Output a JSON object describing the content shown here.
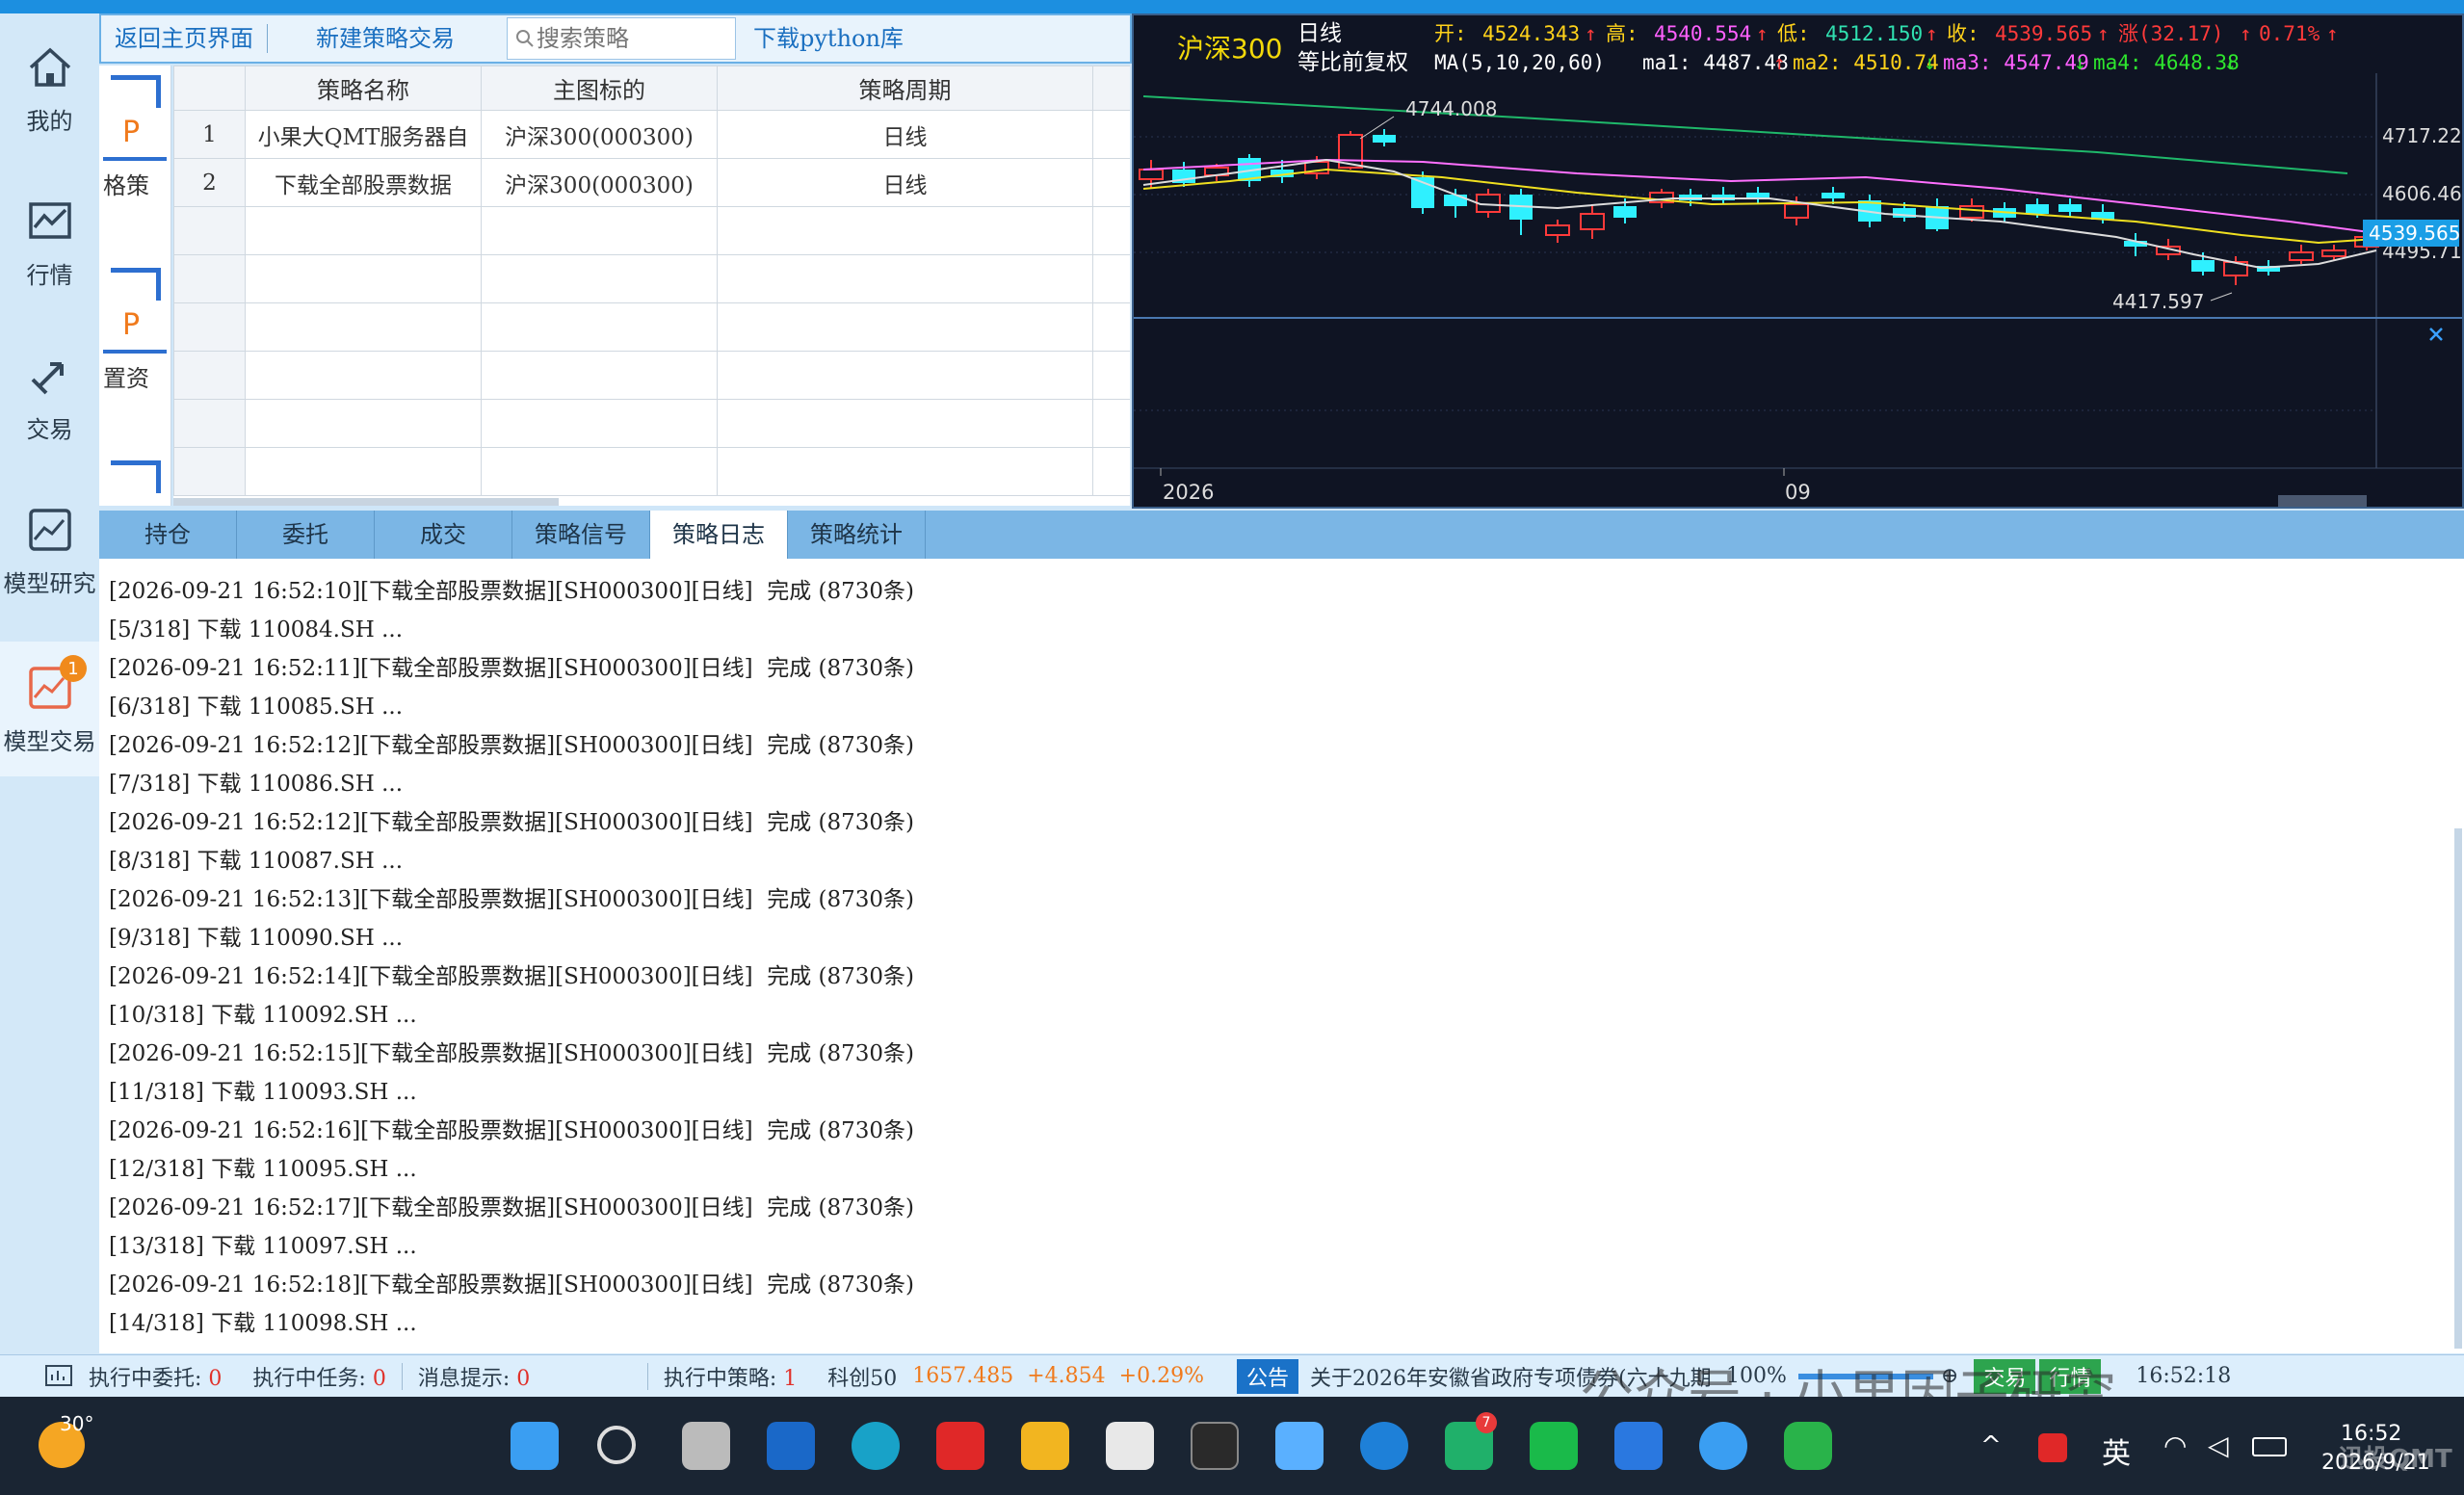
{
  "sidebar": {
    "items": [
      {
        "label": "我的"
      },
      {
        "label": "行情"
      },
      {
        "label": "交易"
      },
      {
        "label": "模型研究"
      },
      {
        "label": "模型交易",
        "badge": "1"
      }
    ]
  },
  "toolbar": {
    "back_label": "返回主页界面",
    "new_label": "新建策略交易",
    "search_placeholder": "搜索策略",
    "download_label": "下载python库"
  },
  "strategy_side": {
    "cards": [
      {
        "tag": "P",
        "text": "格策"
      },
      {
        "tag": "P",
        "text": "置资"
      }
    ]
  },
  "strategy_table": {
    "headers": [
      "策略名称",
      "主图标的",
      "策略周期"
    ],
    "rows": [
      {
        "idx": "1",
        "name": "小果大QMT服务器自",
        "symbol": "沪深300(000300)",
        "period": "日线"
      },
      {
        "idx": "2",
        "name": "下载全部股票数据",
        "symbol": "沪深300(000300)",
        "period": "日线"
      }
    ]
  },
  "chart": {
    "name": "沪深300",
    "period": "日线",
    "adjust": "等比前复权",
    "open_label": "开:",
    "open": "4524.343",
    "high_label": "高:",
    "high": "4540.554",
    "low_label": "低:",
    "low": "4512.150",
    "close_label": "收:",
    "close": "4539.565",
    "change_label": "涨(32.17)",
    "change_pct": "0.71%",
    "ma_label": "MA(5,10,20,60)",
    "ma1": "ma1: 4487.48",
    "ma2": "ma2: 4510.74",
    "ma3": "ma3: 4547.49",
    "ma4": "ma4: 4648.38",
    "price_labels": [
      "4717.224",
      "4606.468",
      "4495.712"
    ],
    "current_price": "4539.565",
    "peak": "4744.008",
    "trough": "4417.597",
    "x_labels": [
      "2026",
      "09"
    ],
    "close_icon": "close-icon"
  },
  "tabs": [
    "持仓",
    "委托",
    "成交",
    "策略信号",
    "策略日志",
    "策略统计"
  ],
  "active_tab": "策略日志",
  "log_lines": [
    "[2026-09-21 16:52:10][下载全部股票数据][SH000300][日线]  完成 (8730条)",
    "[5/318] 下载 110084.SH ...",
    "[2026-09-21 16:52:11][下载全部股票数据][SH000300][日线]  完成 (8730条)",
    "[6/318] 下载 110085.SH ...",
    "[2026-09-21 16:52:12][下载全部股票数据][SH000300][日线]  完成 (8730条)",
    "[7/318] 下载 110086.SH ...",
    "[2026-09-21 16:52:12][下载全部股票数据][SH000300][日线]  完成 (8730条)",
    "[8/318] 下载 110087.SH ...",
    "[2026-09-21 16:52:13][下载全部股票数据][SH000300][日线]  完成 (8730条)",
    "[9/318] 下载 110090.SH ...",
    "[2026-09-21 16:52:14][下载全部股票数据][SH000300][日线]  完成 (8730条)",
    "[10/318] 下载 110092.SH ...",
    "[2026-09-21 16:52:15][下载全部股票数据][SH000300][日线]  完成 (8730条)",
    "[11/318] 下载 110093.SH ...",
    "[2026-09-21 16:52:16][下载全部股票数据][SH000300][日线]  完成 (8730条)",
    "[12/318] 下载 110095.SH ...",
    "[2026-09-21 16:52:17][下载全部股票数据][SH000300][日线]  完成 (8730条)",
    "[13/318] 下载 110097.SH ...",
    "[2026-09-21 16:52:18][下载全部股票数据][SH000300][日线]  完成 (8730条)",
    "[14/318] 下载 110098.SH ..."
  ],
  "status": {
    "entrust_label": "执行中委托:",
    "entrust": "0",
    "tasks_label": "执行中任务:",
    "tasks": "0",
    "msg_label": "消息提示:",
    "msg": "0",
    "strategies_label": "执行中策略:",
    "strategies": "1",
    "index_name": "科创50",
    "index_value": "1657.485",
    "index_change": "+4.854",
    "index_pct": "+0.29%",
    "notice_label": "公告",
    "notice_text": "关于2026年安徽省政府专项债券(六十九期",
    "watermark": "公众号 · 小果因子研究",
    "zoom": "100%",
    "trade_btn": "交易",
    "quote_btn": "行情",
    "time": "16:52:18"
  },
  "taskbar": {
    "weather": "30°",
    "clock": "16:52",
    "date": "2026/9/21",
    "ime": "英",
    "wechat_badge": "7",
    "corner_text": "迅投QMT"
  },
  "colors": {
    "up": "#ff3a3a",
    "down": "#2ff0ff",
    "accent": "#1c8fe0"
  }
}
